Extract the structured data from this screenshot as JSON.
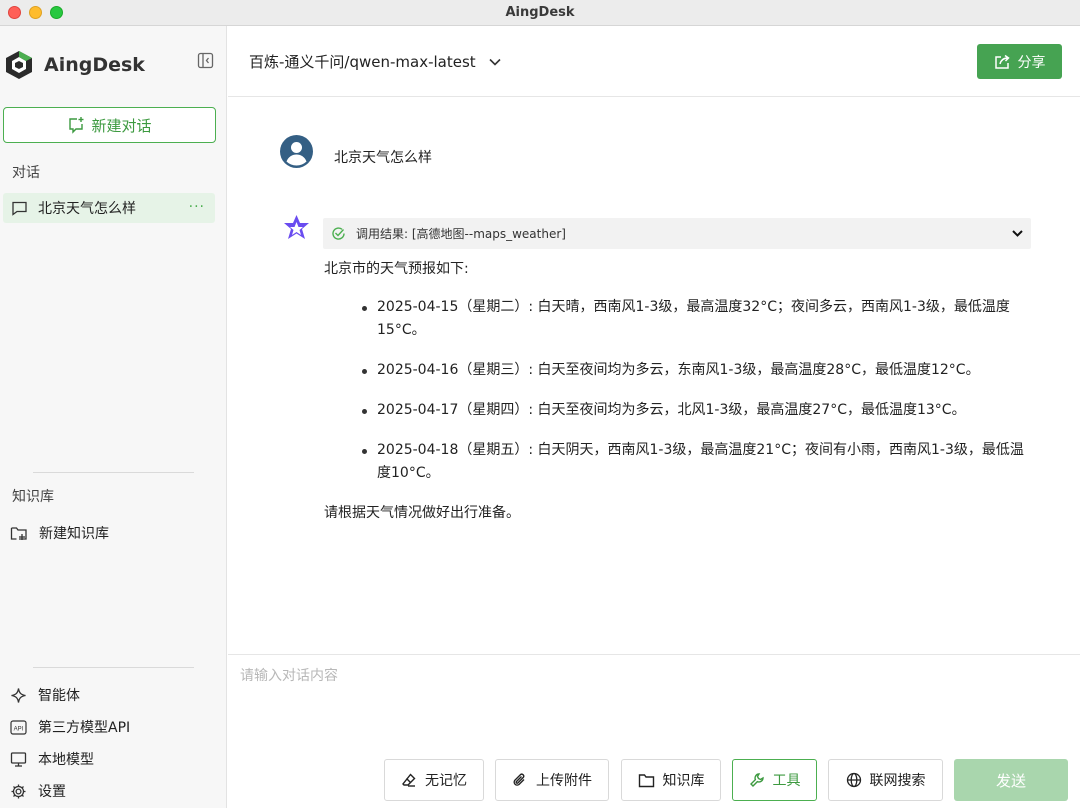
{
  "window": {
    "title": "AingDesk"
  },
  "colors": {
    "accent": "#46a352",
    "accent_light": "#e6f3e7",
    "send_disabled": "#a9d6ad"
  },
  "sidebar": {
    "brand": "AingDesk",
    "new_chat_label": "新建对话",
    "conversations_label": "对话",
    "conversations": [
      {
        "title": "北京天气怎么样",
        "more": "···"
      }
    ],
    "knowledge_label": "知识库",
    "new_knowledge_label": "新建知识库",
    "bottom_links": [
      {
        "label": "智能体",
        "icon": "sparkle-icon"
      },
      {
        "label": "第三方模型API",
        "icon": "api-icon"
      },
      {
        "label": "本地模型",
        "icon": "monitor-icon"
      },
      {
        "label": "设置",
        "icon": "gear-icon"
      }
    ]
  },
  "header": {
    "model": "百炼-通义千问/qwen-max-latest",
    "share_label": "分享"
  },
  "chat": {
    "user_message": "北京天气怎么样",
    "tool_result": "调用结果: [高德地图--maps_weather]",
    "answer": {
      "intro": "北京市的天气预报如下:",
      "items": [
        "2025-04-15（星期二）: 白天晴，西南风1-3级，最高温度32°C；夜间多云，西南风1-3级，最低温度15°C。",
        "2025-04-16（星期三）: 白天至夜间均为多云，东南风1-3级，最高温度28°C，最低温度12°C。",
        "2025-04-17（星期四）: 白天至夜间均为多云，北风1-3级，最高温度27°C，最低温度13°C。",
        "2025-04-18（星期五）: 白天阴天，西南风1-3级，最高温度21°C；夜间有小雨，西南风1-3级，最低温度10°C。"
      ],
      "outro": "请根据天气情况做好出行准备。"
    }
  },
  "composer": {
    "placeholder": "请输入对话内容",
    "buttons": {
      "memory": "无记忆",
      "upload": "上传附件",
      "knowledge": "知识库",
      "tools": "工具",
      "web_search": "联网搜索"
    },
    "send_label": "发送"
  }
}
